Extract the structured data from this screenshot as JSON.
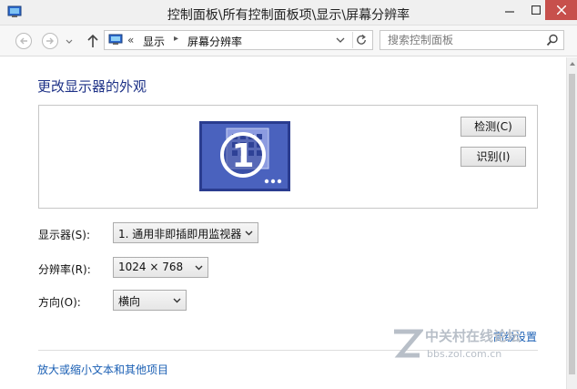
{
  "window": {
    "title": "控制面板\\所有控制面板项\\显示\\屏幕分辨率"
  },
  "address": {
    "chevrons": "«",
    "crumbs": [
      "显示",
      "屏幕分辨率"
    ],
    "search_placeholder": "搜索控制面板"
  },
  "content": {
    "heading": "更改显示器的外观",
    "monitor_number": "1",
    "buttons": {
      "detect": "检测(C)",
      "identify": "识别(I)"
    },
    "fields": {
      "display_label": "显示器(S):",
      "display_value": "1. 通用非即插即用监视器",
      "resolution_label": "分辨率(R):",
      "resolution_value": "1024 × 768",
      "orientation_label": "方向(O):",
      "orientation_value": "横向"
    },
    "advanced_link": "高级设置",
    "links": [
      "放大或缩小文本和其他项目"
    ]
  },
  "watermark": {
    "text": "中关村在线论坛",
    "url": "bbs.zol.com.cn"
  },
  "colors": {
    "heading": "#1e3287",
    "link": "#1a5fb4",
    "close_button": "#c7504c",
    "monitor_blue": "#3a4ea8"
  },
  "icons": {
    "app": "display-settings-icon",
    "back": "back-arrow-icon",
    "forward": "forward-arrow-icon",
    "up": "up-arrow-icon",
    "refresh": "refresh-icon",
    "search": "search-icon"
  }
}
